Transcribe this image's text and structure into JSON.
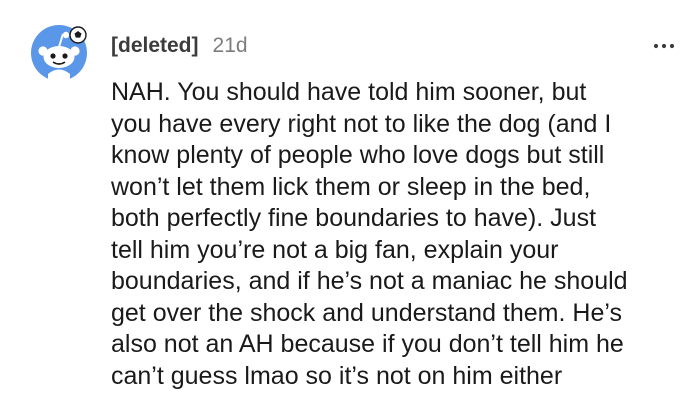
{
  "comment": {
    "author": "[deleted]",
    "age": "21d",
    "avatar_icon": "reddit-snoo-avatar-icon",
    "more_icon": "more-options-icon",
    "accent_color": "#4a90e2",
    "lines": [
      "NAH. You should have told him sooner, but",
      "you have every right not to like the dog (and I",
      "know plenty of people who love dogs but still",
      "won’t let them lick them or sleep in the bed,",
      "both perfectly fine boundaries to have). Just",
      "tell him you’re not a big fan, explain your",
      "boundaries, and if he’s not a maniac he should",
      "get over the shock and understand them. He’s",
      "also not an AH because if you don’t tell him he",
      "can’t guess lmao so it’s not on him either"
    ]
  }
}
